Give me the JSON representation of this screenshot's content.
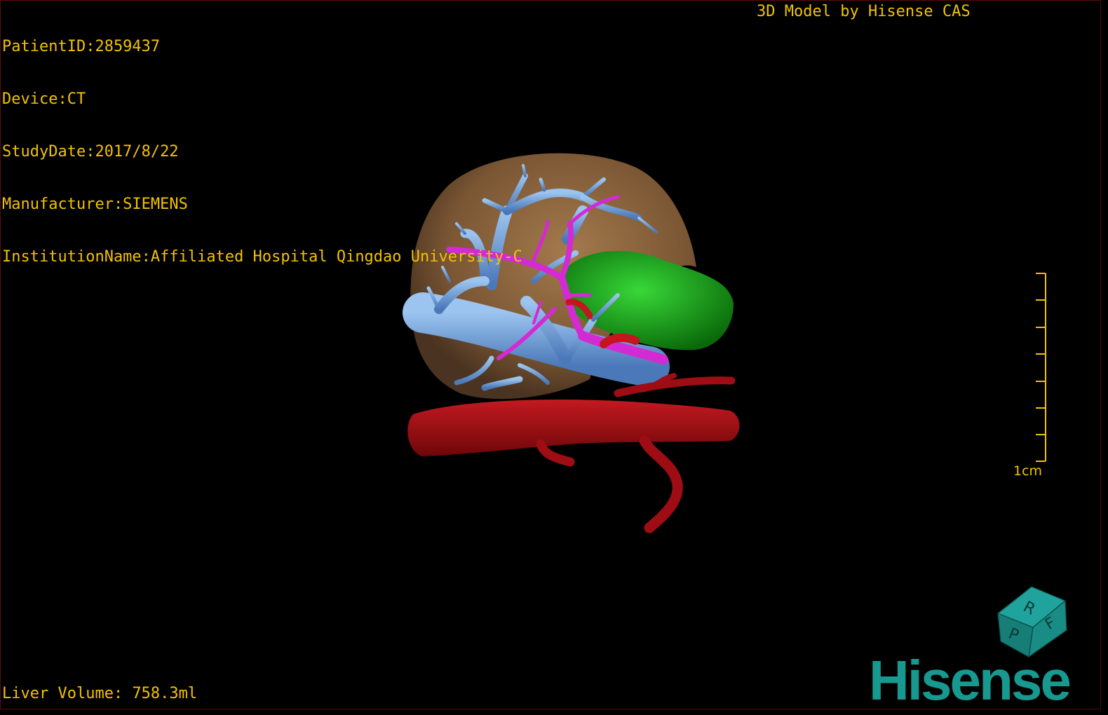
{
  "viewer": {
    "patient_id": "PatientID:2859437",
    "device": "Device:CT",
    "study_date": "StudyDate:2017/8/22",
    "manufacturer": "Manufacturer:SIEMENS",
    "institution": "InstitutionName:Affiliated Hospital Qingdao University-C",
    "model_credit": "3D Model by Hisense CAS",
    "liver_volume": "Liver Volume: 758.3ml",
    "scale_label": "1cm",
    "brand": "Hisense"
  },
  "orientation_cube": {
    "face_labels": [
      "R",
      "F",
      "P"
    ],
    "color": "#1a8c86"
  },
  "model_structures": [
    {
      "name": "liver",
      "color": "#8a6440"
    },
    {
      "name": "portal-vein",
      "color": "#6e9fd8"
    },
    {
      "name": "hepatic-artery",
      "color": "#d42ad4"
    },
    {
      "name": "tumor",
      "color": "#139c13"
    },
    {
      "name": "aorta",
      "color": "#9e0d13"
    }
  ],
  "colors": {
    "overlay_text": "#f2c200",
    "brand": "#17998f",
    "background": "#000000"
  }
}
